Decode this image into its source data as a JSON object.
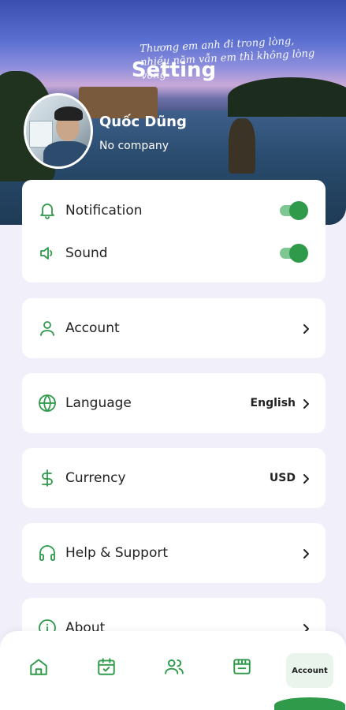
{
  "header": {
    "title": "Setting",
    "script_caption": "Thương em anh đi trong lòng, nhiều năm vẫn em thì không lòng vòng"
  },
  "profile": {
    "name": "Quốc Dũng",
    "company": "No company"
  },
  "toggles": [
    {
      "label": "Notification",
      "icon": "bell-icon",
      "enabled": true
    },
    {
      "label": "Sound",
      "icon": "speaker-icon",
      "enabled": true
    }
  ],
  "menu": {
    "account": {
      "label": "Account",
      "icon": "user-icon"
    },
    "language": {
      "label": "Language",
      "value": "English",
      "icon": "globe-icon"
    },
    "currency": {
      "label": "Currency",
      "value": "USD",
      "icon": "dollar-icon"
    },
    "help": {
      "label": "Help & Support",
      "icon": "headphones-icon"
    },
    "about": {
      "label": "About",
      "icon": "info-icon"
    }
  },
  "bottom_nav": {
    "items": [
      "home-icon",
      "calendar-check-icon",
      "users-icon",
      "store-icon"
    ],
    "active_label": "Account"
  },
  "colors": {
    "accent": "#2e9a4a",
    "background": "#f1f0fa"
  }
}
